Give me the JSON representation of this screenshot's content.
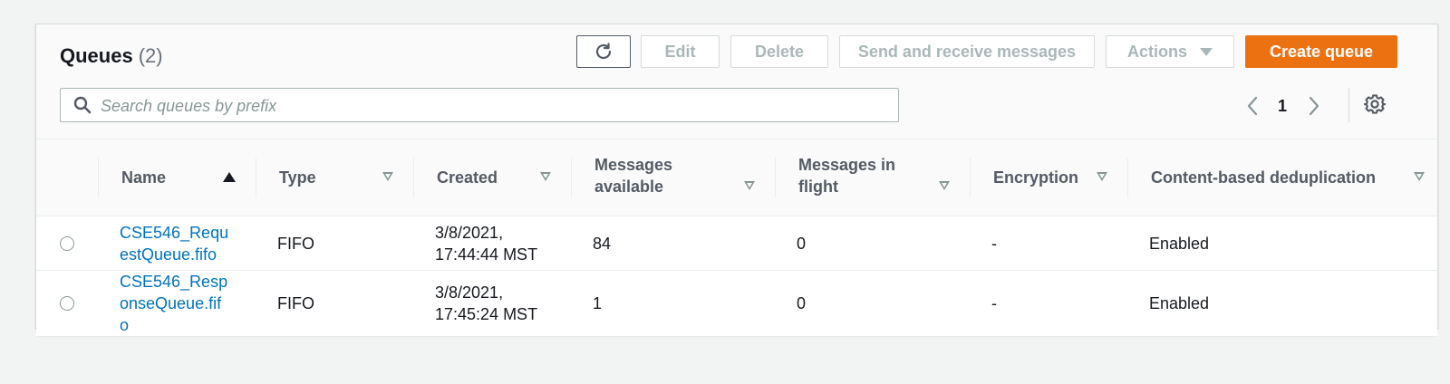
{
  "header": {
    "title": "Queues",
    "count": "(2)"
  },
  "toolbar": {
    "refresh_icon": "refresh-icon",
    "edit_label": "Edit",
    "delete_label": "Delete",
    "send_receive_label": "Send and receive messages",
    "actions_label": "Actions",
    "create_label": "Create queue"
  },
  "search": {
    "placeholder": "Search queues by prefix",
    "value": ""
  },
  "pagination": {
    "current_page": "1"
  },
  "table": {
    "columns": [
      "Name",
      "Type",
      "Created",
      "Messages available",
      "Messages in flight",
      "Encryption",
      "Content-based deduplication"
    ],
    "sorted_column": "Name",
    "sort_direction": "ascending",
    "rows": [
      {
        "name": "CSE546_RequestQueue.fifo",
        "type": "FIFO",
        "created": "3/8/2021, 17:44:44 MST",
        "messages_available": "84",
        "messages_in_flight": "0",
        "encryption": "-",
        "dedup": "Enabled",
        "selected": false
      },
      {
        "name": "CSE546_ResponseQueue.fifo",
        "type": "FIFO",
        "created": "3/8/2021, 17:45:24 MST",
        "messages_available": "1",
        "messages_in_flight": "0",
        "encryption": "-",
        "dedup": "Enabled",
        "selected": false
      }
    ]
  },
  "colors": {
    "primary_button": "#ec7211",
    "link": "#0073bb",
    "disabled_text": "#aab7b8"
  }
}
